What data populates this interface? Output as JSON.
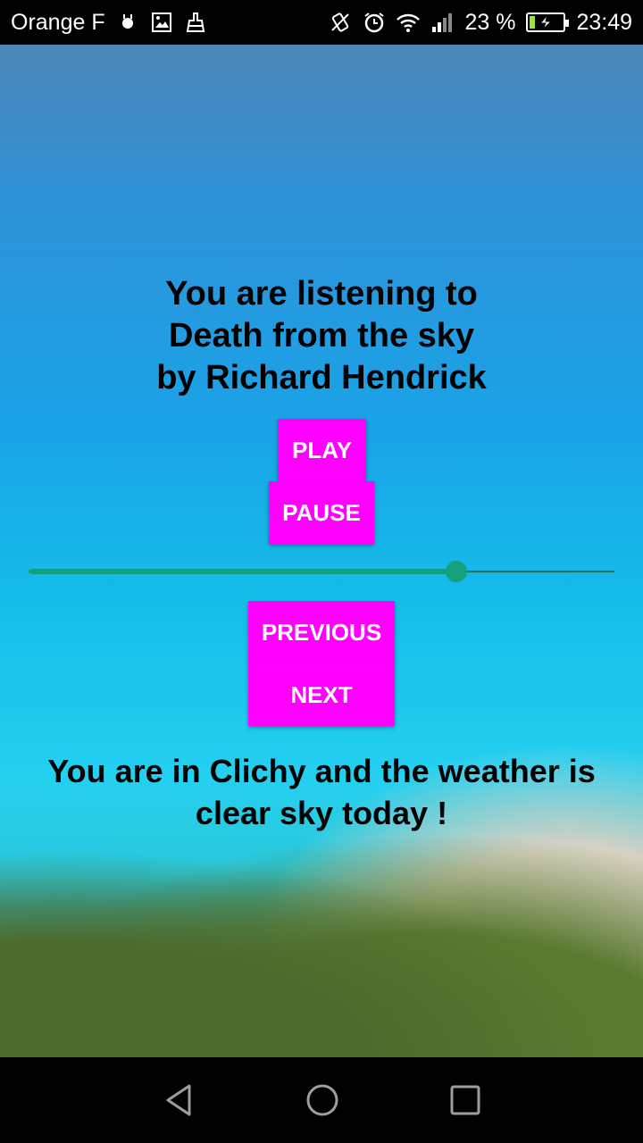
{
  "status_bar": {
    "carrier": "Orange F",
    "battery_percent": "23 %",
    "battery_level": 0.23,
    "time": "23:49",
    "icons": [
      "android-debug-icon",
      "gallery-icon",
      "cleaner-icon",
      "vibrate-icon",
      "alarm-icon",
      "wifi-icon",
      "signal-icon",
      "battery-charging-icon"
    ]
  },
  "player": {
    "line1": "You are listening to",
    "line2": "Death from the sky",
    "line3": "by Richard Hendrick",
    "play_label": "PLAY",
    "pause_label": "PAUSE",
    "previous_label": "PREVIOUS",
    "next_label": "NEXT",
    "progress": 0.73,
    "accent_color": "#ff00ff",
    "seek_color": "#13a07a"
  },
  "weather": {
    "line1": "You are in Clichy and the weather is",
    "line2": "clear sky today !"
  },
  "nav_bar": {
    "icons": [
      "back-icon",
      "home-icon",
      "recents-icon"
    ]
  }
}
